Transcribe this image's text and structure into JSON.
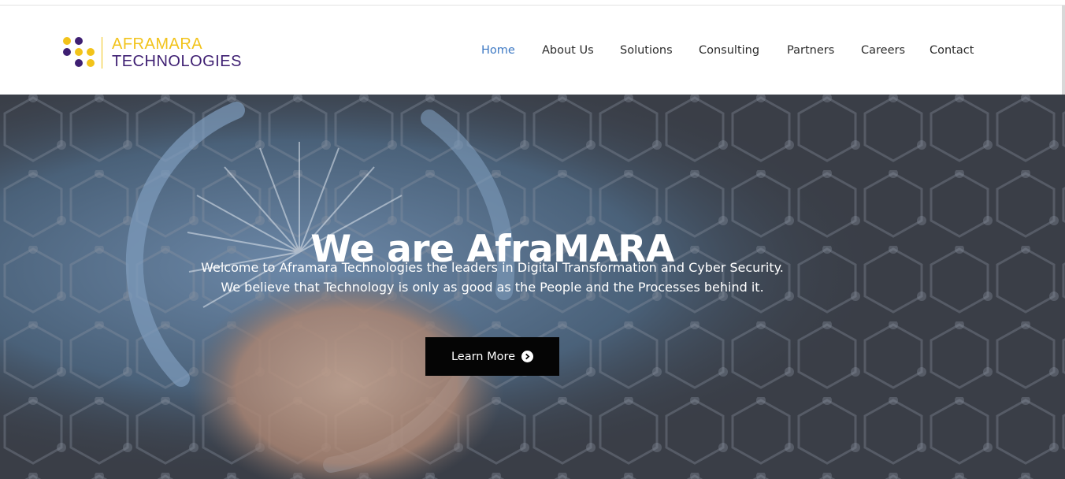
{
  "brand": {
    "line1": "AFRAMARA",
    "line2": "TECHNOLOGIES",
    "colors": {
      "yellow": "#f2c31a",
      "purple": "#3e1f72"
    },
    "icon": "dot-grid-logo-icon"
  },
  "nav": {
    "items": [
      {
        "label": "Home",
        "active": true
      },
      {
        "label": "About Us",
        "active": false
      },
      {
        "label": "Solutions",
        "active": false
      },
      {
        "label": "Consulting",
        "active": false
      },
      {
        "label": "Partners",
        "active": false
      },
      {
        "label": "Careers",
        "active": false
      },
      {
        "label": "Contact",
        "active": false
      }
    ],
    "active_color": "#3d79c4"
  },
  "hero": {
    "title": "We are AfraMARA",
    "line1": "Welcome to Aframara Technologies the leaders in Digital Transformation and Cyber Security.",
    "line2": "We believe that Technology is only as good as the People and the Processes behind it.",
    "cta_label": "Learn More",
    "cta_icon": "chevron-right-circle-icon"
  }
}
